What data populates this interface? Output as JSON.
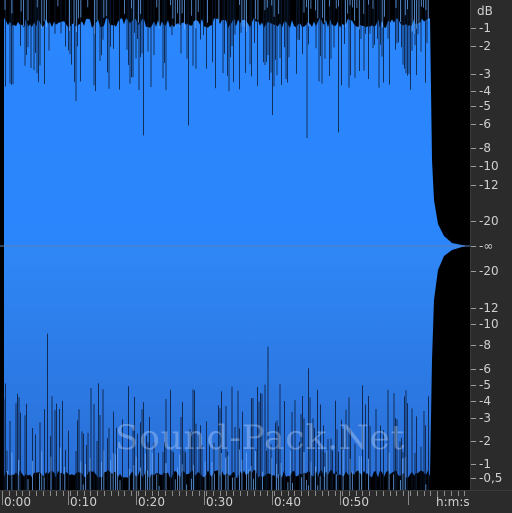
{
  "db_ruler": {
    "unit": "dB",
    "labels": [
      "-1",
      "-2",
      "-3",
      "-4",
      "-5",
      "-6",
      "-8",
      "-10",
      "-12",
      "-20",
      "-∞",
      "-20",
      "-12",
      "-10",
      "-8",
      "-6",
      "-5",
      "-4",
      "-3",
      "-2",
      "-1",
      "-0,5"
    ]
  },
  "time_ruler": {
    "labels": [
      "0:00",
      "0:10",
      "0:20",
      "0:30",
      "0:40",
      "0:50"
    ],
    "unit": "h:m:s"
  },
  "waveform": {
    "fill_color": "#2b87ff",
    "peak_color": "#7db7ff",
    "background": "#000000",
    "gradient_bottom": "#2a70d8"
  },
  "watermark": {
    "text": "Sound-Pack.Net"
  },
  "colors": {
    "ruler_bg": "#2b2b2b",
    "ruler_text": "#cfcfcf"
  }
}
